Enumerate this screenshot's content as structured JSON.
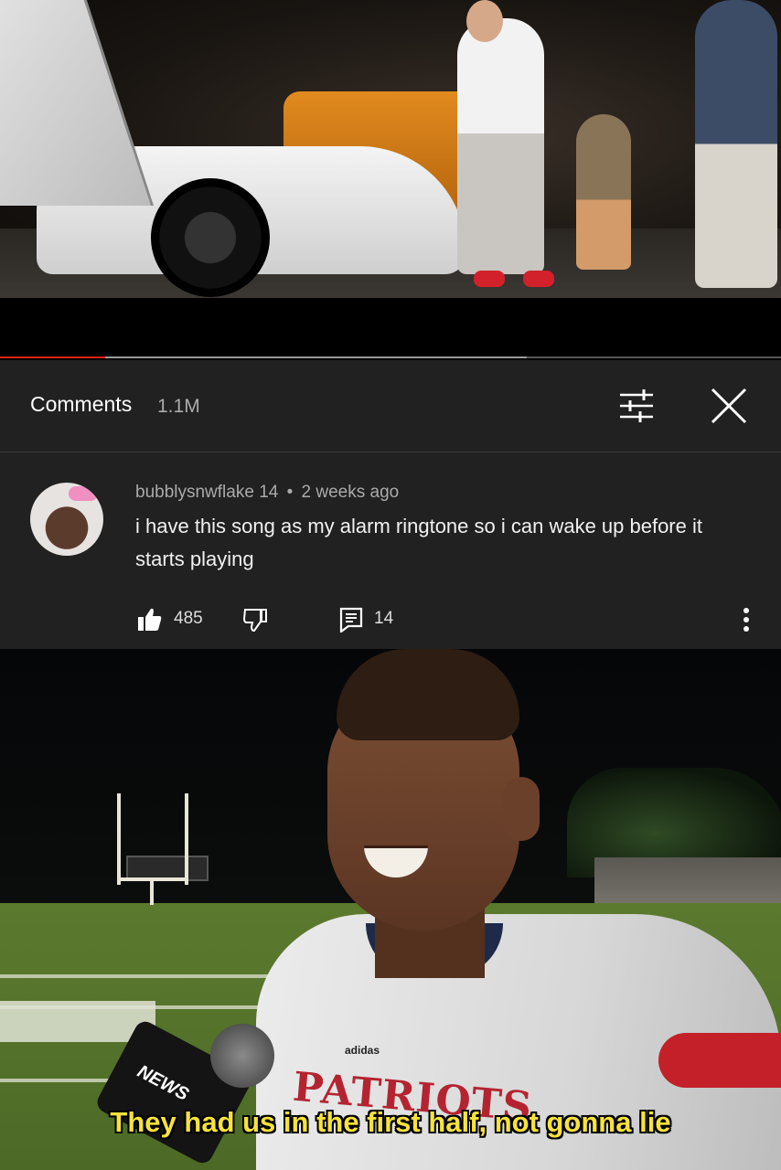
{
  "video": {
    "progress_played": 0.135,
    "progress_buffered": 0.675,
    "colors": {
      "played": "#e62117",
      "buffer": "#9a9a9a",
      "track": "#555555"
    }
  },
  "comments_panel": {
    "title": "Comments",
    "count": "1.1M",
    "sort_icon": "sort-filter-icon",
    "close_icon": "close-icon",
    "background": "#212121"
  },
  "comment": {
    "author": "bubblysnwflake 14",
    "separator": "•",
    "time": "2 weeks ago",
    "text": "i have this song as my alarm ringtone so i can wake up before it starts playing",
    "likes": "485",
    "replies": "14",
    "icons": {
      "like": "thumbs-up-icon",
      "dislike": "thumbs-down-icon",
      "reply": "reply-icon",
      "more": "more-vert-icon"
    }
  },
  "meme": {
    "caption": "They had us in the first half, not gonna lie",
    "jersey_text": "PATRIOTS",
    "brand_text": "adidas",
    "mic_logo": "NEWS",
    "caption_color": "#f6e23b"
  }
}
